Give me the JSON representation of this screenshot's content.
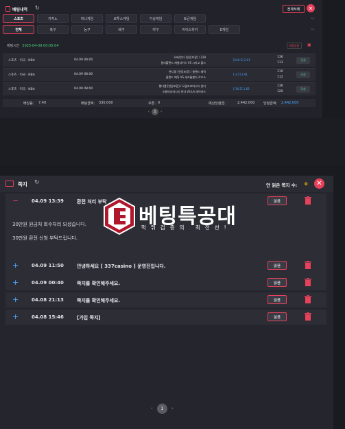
{
  "bet_window": {
    "title": "배팅내역",
    "delete_all_label": "전체삭제",
    "tabs_row1": [
      "스포츠",
      "카지노",
      "미니게임",
      "로투스게임",
      "가상게임",
      "토큰게임"
    ],
    "tabs_row2": [
      "전체",
      "축구",
      "농구",
      "배구",
      "야구",
      "아이스하키",
      "E게임"
    ],
    "bet_time_label": "배팅시간",
    "bet_time_value": "2025-04-09 00:05:04",
    "refresh_label": "최종당첨",
    "rows": [
      {
        "sport": "스포츠 · 미국 · NBA",
        "date": "04.09 08:00",
        "team_a": "오버/언더 [연장포함] / 229",
        "team_b": "클리블랜드 캐벌리어스 VS 시카고 불스",
        "pick": "[240.5] 2.01",
        "odds": "",
        "score_a": "136",
        "score_b": "113",
        "status": "당첨"
      },
      {
        "sport": "스포츠 · 미국 · NBA",
        "date": "04.09 08:00",
        "team_a": "핸디캡 [연장포함] / 클랜드 매직",
        "team_b": "클랜드 매직 VS 세츠롱젠더 로즈스",
        "pick": "[-3.5] 1.91",
        "odds": "",
        "score_a": "119",
        "score_b": "112",
        "status": "당첨"
      },
      {
        "sport": "스포츠 · 미국 · NBA",
        "date": "04.09 08:00",
        "team_a": "핸디캡 [연장포함] / 오클라호마시티 썬더",
        "team_b": "오클라호마시티 썬더 VS LA 레이커스",
        "pick": "[-16.5] 1.83",
        "odds": "",
        "score_a": "136",
        "score_b": "120",
        "status": "당첨"
      }
    ],
    "summary": {
      "bet_rate_label": "배당률:",
      "bet_rate": "7.40",
      "bet_amount_label": "배팅금액:",
      "bet_amount": "330,000",
      "coupon_label": "쿠폰:",
      "coupon": "0",
      "expected_label": "예상당첨금:",
      "expected": "2,442,000",
      "win_label": "당첨금액:",
      "win": "2,442,000"
    },
    "page": "1"
  },
  "note_window": {
    "title": "쪽지",
    "unread_label": "안 읽은 쪽지 수:",
    "unread_count": "0",
    "expanded": {
      "date": "04.09 13:39",
      "subject": "환전 처리 부탁",
      "body_line1": "30만원 원금처 회수처리 되셨습니다.",
      "body_line2": "30만원 환전 신청 부탁드립니다.",
      "read_label": "읽음"
    },
    "messages": [
      {
        "date": "04.09 11:50",
        "subject": "안녕하세요 [ 337casino ] 운영진입니다.",
        "read_label": "읽음"
      },
      {
        "date": "04.09 00:40",
        "subject": "쪽지를 확인해주세요.",
        "read_label": "읽음"
      },
      {
        "date": "04.08 21:13",
        "subject": "쪽지를 확인해주세요.",
        "read_label": "읽음"
      },
      {
        "date": "04.08 15:46",
        "subject": "[가입 쪽지]",
        "read_label": "읽음"
      }
    ],
    "page": "1"
  },
  "watermark": {
    "title": "베팅특공대",
    "subtitle": "먹튀검증의 최전선!"
  }
}
